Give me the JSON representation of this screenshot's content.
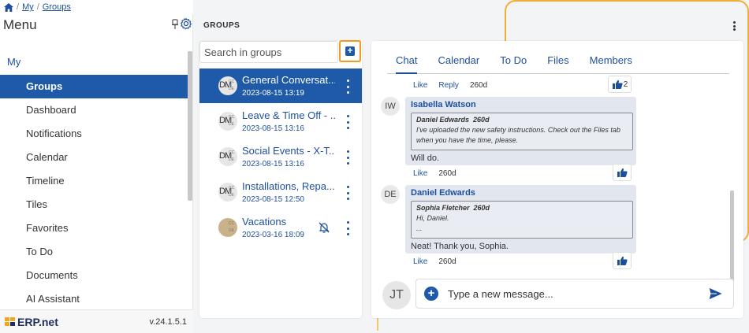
{
  "breadcrumb": {
    "items": [
      "My",
      "Groups"
    ]
  },
  "sidebar": {
    "title": "Menu",
    "section": "My",
    "items": [
      {
        "label": "Groups"
      },
      {
        "label": "Dashboard"
      },
      {
        "label": "Notifications"
      },
      {
        "label": "Calendar"
      },
      {
        "label": "Timeline"
      },
      {
        "label": "Tiles"
      },
      {
        "label": "Favorites"
      },
      {
        "label": "To Do"
      },
      {
        "label": "Documents"
      },
      {
        "label": "AI Assistant"
      }
    ],
    "active_item": "Groups",
    "logo": "ERP.net",
    "version": "v.24.1.5.1"
  },
  "main": {
    "title": "GROUPS"
  },
  "groups": {
    "search_placeholder": "Search in groups",
    "items": [
      {
        "name": "General Conversat...",
        "date": "2023-08-15 13:19",
        "avatar": [
          "DM",
          "CC",
          "DE"
        ],
        "active": true
      },
      {
        "name": "Leave & Time Off - ...",
        "date": "2023-08-15 13:16",
        "avatar": [
          "DM",
          "CC",
          "DE"
        ]
      },
      {
        "name": "Social Events - X-T...",
        "date": "2023-08-15 13:16",
        "avatar": [
          "DM",
          "CC",
          "DE"
        ]
      },
      {
        "name": "Installations, Repa...",
        "date": "2023-08-15 12:50",
        "avatar": [
          "DM",
          "CC",
          "DE"
        ]
      },
      {
        "name": "Vacations",
        "date": "2023-03-16 18:09",
        "avatar": [
          "",
          "CC",
          "DE"
        ],
        "muted": true
      }
    ]
  },
  "chat": {
    "tabs": [
      "Chat",
      "Calendar",
      "To Do",
      "Files",
      "Members"
    ],
    "active_tab": "Chat",
    "top_actions": {
      "like": "Like",
      "reply": "Reply",
      "time": "260d",
      "like_count": "2"
    },
    "messages": [
      {
        "avatar": "IW",
        "author": "Isabella Watson",
        "quote_author": "Daniel Edwards",
        "quote_time": "260d",
        "quote_lines": [
          "I've uploaded the new safety instructions. Check out the Files tab",
          "when you have the time, please."
        ],
        "text": "Will do.",
        "like": "Like",
        "time": "260d"
      },
      {
        "avatar": "DE",
        "author": "Daniel Edwards",
        "quote_author": "Sophia Fletcher",
        "quote_time": "260d",
        "quote_lines": [
          "Hi, Daniel.",
          "..."
        ],
        "text": "Neat! Thank you, Sophia.",
        "like": "Like",
        "time": "260d"
      }
    ],
    "composer": {
      "avatar": "JT",
      "placeholder": "Type a new message..."
    }
  },
  "colors": {
    "primary": "#1e5aa8",
    "accent": "#f09a1e",
    "link": "#1e4f9c"
  }
}
